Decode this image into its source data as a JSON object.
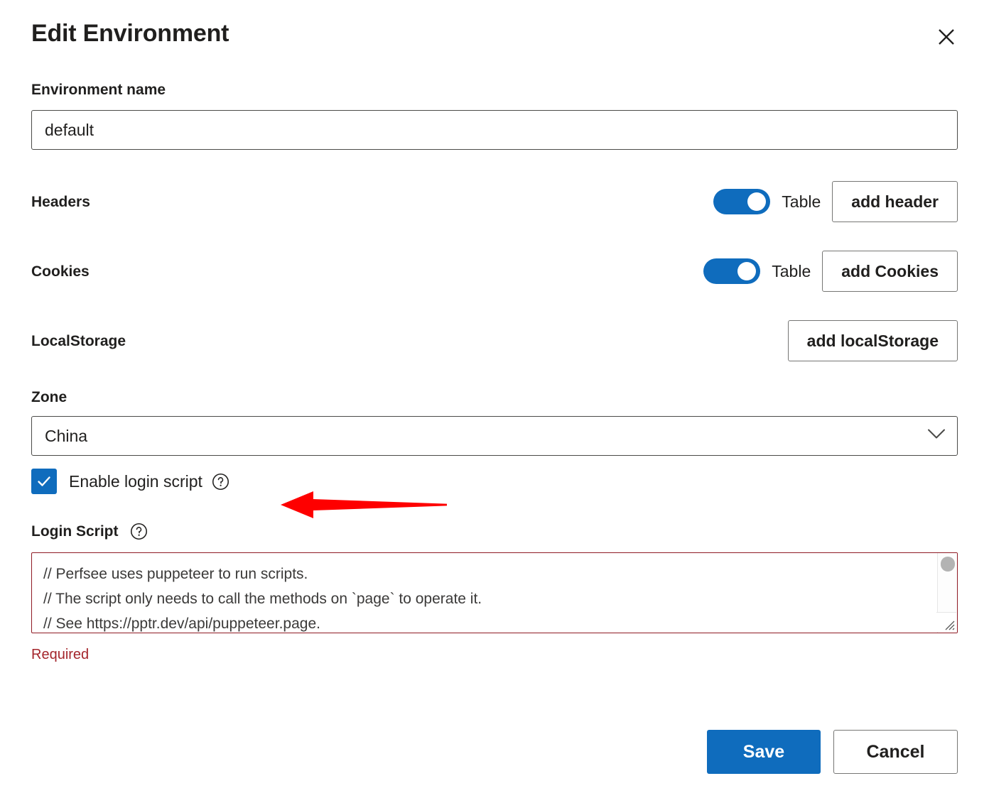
{
  "dialog": {
    "title": "Edit Environment",
    "close_icon": "close-icon"
  },
  "env_name": {
    "label": "Environment name",
    "value": "default",
    "placeholder": "Environment name"
  },
  "headers": {
    "label": "Headers",
    "toggle_on": true,
    "toggle_text": "Table",
    "button_label": "add header"
  },
  "cookies": {
    "label": "Cookies",
    "toggle_on": true,
    "toggle_text": "Table",
    "button_label": "add Cookies"
  },
  "localstorage": {
    "label": "LocalStorage",
    "button_label": "add localStorage"
  },
  "zone": {
    "label": "Zone",
    "selected": "China",
    "chevron_icon": "chevron-down-icon"
  },
  "enable_login_script": {
    "label": "Enable login script",
    "checked": true,
    "help_icon": "help-circle-icon"
  },
  "login_script": {
    "label": "Login Script",
    "help_icon": "help-circle-icon",
    "placeholder": "// Perfsee uses puppeteer to run scripts.\n// The script only needs to call the methods on `page` to operate it.\n// See https://pptr.dev/api/puppeteer.page.",
    "value": "",
    "error": "Required"
  },
  "footer": {
    "save_label": "Save",
    "cancel_label": "Cancel"
  },
  "annotation": {
    "arrow_icon": "left-arrow-annotation",
    "color": "#fe0000"
  },
  "colors": {
    "accent": "#0f6cbd",
    "error": "#a4262c",
    "error_border": "#8f1a24",
    "text": "#201f1e",
    "border": "#767674",
    "input_border": "#4a4a48"
  }
}
